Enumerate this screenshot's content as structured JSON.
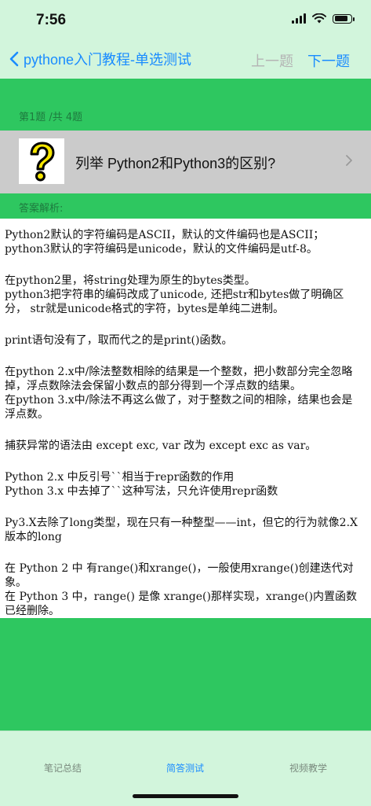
{
  "status_bar": {
    "time": "7:56"
  },
  "nav": {
    "back_label": "pythone入门教程-单选测试",
    "prev_label": "上一题",
    "next_label": "下一题"
  },
  "question": {
    "count_label": "第1题 /共 4题",
    "text": "列举 Python2和Python3的区别?"
  },
  "answer": {
    "label": "答案解析:",
    "paragraphs": [
      "Python2默认的字符编码是ASCII，默认的文件编码也是ASCII；\npython3默认的字符编码是unicode，默认的文件编码是utf-8。",
      "在python2里，将string处理为原生的bytes类型。\npython3把字符串的编码改成了unicode, 还把str和bytes做了明确区分，  str就是unicode格式的字符，bytes是单纯二进制。",
      "print语句没有了，取而代之的是print()函数。",
      "在python 2.x中/除法整数相除的结果是一个整数，把小数部分完全忽略掉，浮点数除法会保留小数点的部分得到一个浮点数的结果。\n在python 3.x中/除法不再这么做了，对于整数之间的相除，结果也会是浮点数。",
      "捕获异常的语法由 except exc, var 改为 except exc as var。",
      "Python 2.x 中反引号``相当于repr函数的作用\nPython 3.x 中去掉了``这种写法，只允许使用repr函数",
      "Py3.X去除了long类型，现在只有一种整型——int，但它的行为就像2.X版本的long",
      "在 Python 2 中 有range()和xrange()，一般使用xrange()创建迭代对象。\n在 Python 3 中，range() 是像 xrange()那样实现，xrange()内置函数已经删除。"
    ]
  },
  "tabs": [
    {
      "label": "笔记总结",
      "active": false
    },
    {
      "label": "简答测试",
      "active": true
    },
    {
      "label": "视频教学",
      "active": false
    }
  ],
  "colors": {
    "green": "#2ec760",
    "light_green": "#d2f5dc",
    "accent_blue": "#1a8cff",
    "card_gray": "#cbcbcb"
  },
  "icons": [
    "wifi-icon",
    "battery-icon",
    "signal-icon",
    "back-chevron-icon",
    "question-mark-icon",
    "chevron-right-icon"
  ]
}
